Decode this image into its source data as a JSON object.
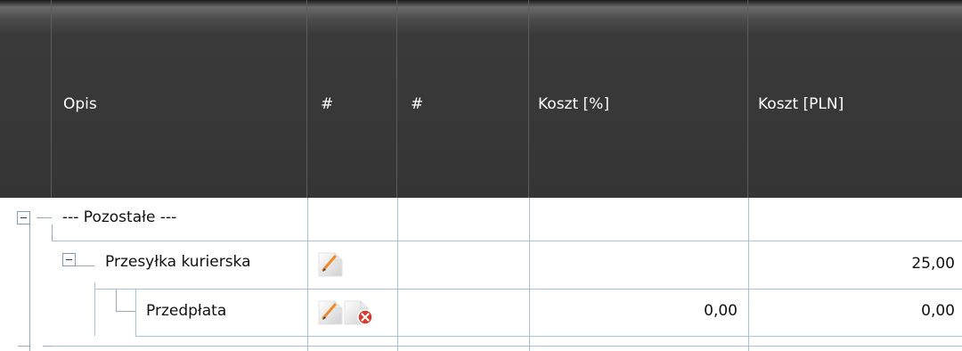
{
  "columns": [
    {
      "label": ""
    },
    {
      "label": "Opis"
    },
    {
      "label": "#"
    },
    {
      "label": "#"
    },
    {
      "label": "Koszt [%]"
    },
    {
      "label": "Koszt [PLN]"
    }
  ],
  "rows": [
    {
      "label": "--- Pozostałe ---",
      "koszt_pct": "",
      "koszt_pln": ""
    },
    {
      "label": "Przesyłka kurierska",
      "koszt_pct": "",
      "koszt_pln": "25,00"
    },
    {
      "label": "Przedpłata",
      "koszt_pct": "0,00",
      "koszt_pln": "0,00"
    }
  ],
  "icons": {
    "edit": "pencil-edit-icon",
    "delete": "delete-icon",
    "expander": "tree-collapse-icon"
  },
  "colors": {
    "header_bg": "#353535",
    "grid_line": "#a9c1d6",
    "delete_badge": "#d93a2b"
  }
}
